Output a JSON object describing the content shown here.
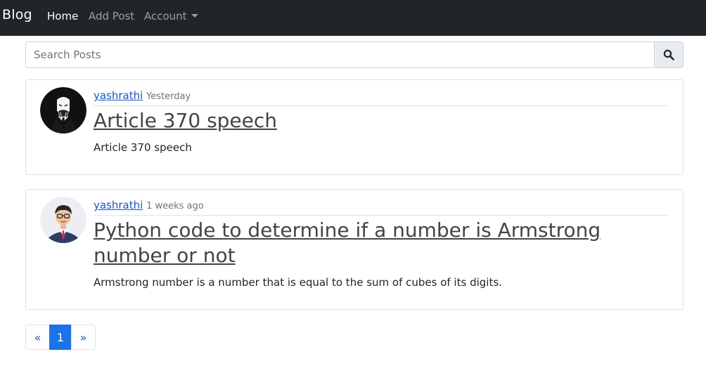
{
  "navbar": {
    "brand": "Blog",
    "links": [
      {
        "label": "Home"
      },
      {
        "label": "Add Post"
      },
      {
        "label": "Account"
      }
    ]
  },
  "search": {
    "placeholder": "Search Posts",
    "icon": "search-icon"
  },
  "posts": [
    {
      "author": "yashrathi",
      "date": "Yesterday",
      "title": "Article 370 speech",
      "excerpt": "Article 370 speech",
      "avatar_icon": "avatar-suit-figure"
    },
    {
      "author": "yashrathi",
      "date": "1 weeks ago",
      "title": "Python code to determine if a number is Armstrong number or not",
      "excerpt": "Armstrong number is a number that is equal to the sum of cubes of its digits.",
      "avatar_icon": "avatar-cartoon-man"
    }
  ],
  "pagination": {
    "prev": "«",
    "pages": [
      "1"
    ],
    "next": "»",
    "current": "1"
  },
  "colors": {
    "navbar_bg": "#212529",
    "link": "#1a55c7",
    "active_page": "#1a73e8"
  }
}
